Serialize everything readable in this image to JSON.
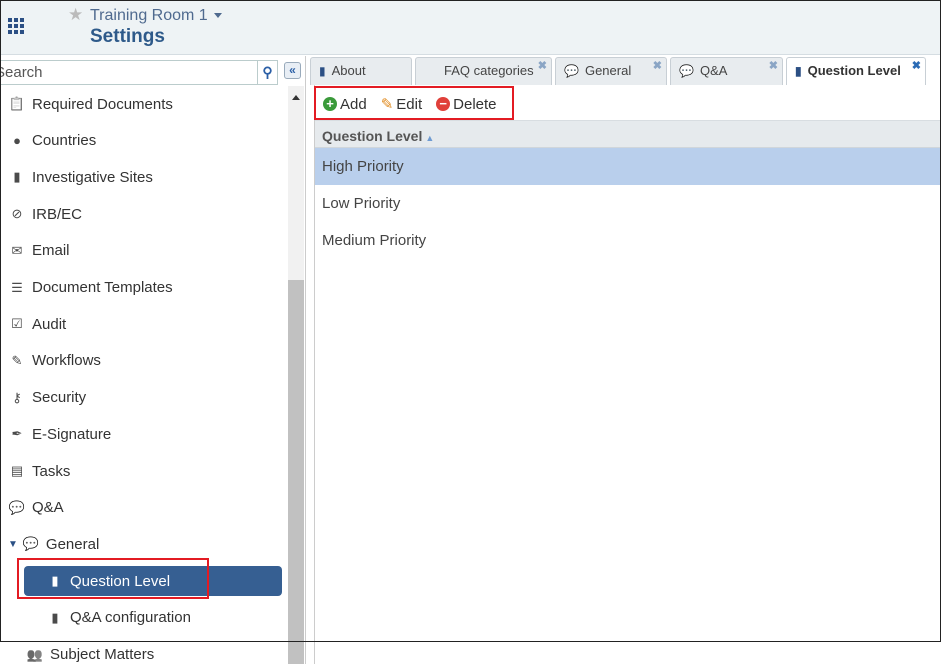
{
  "header": {
    "room": "Training Room 1",
    "title": "Settings",
    "apps_icon": "grid-icon",
    "star_icon": "star-icon"
  },
  "sidebar": {
    "search_placeholder": "Search",
    "items": [
      {
        "label": "Required Documents",
        "icon": "clipboard-icon"
      },
      {
        "label": "Countries",
        "icon": "globe-icon"
      },
      {
        "label": "Investigative Sites",
        "icon": "building-icon"
      },
      {
        "label": "IRB/EC",
        "icon": "check-circle-icon"
      },
      {
        "label": "Email",
        "icon": "envelope-icon"
      },
      {
        "label": "Document Templates",
        "icon": "list-icon"
      },
      {
        "label": "Audit",
        "icon": "checkbox-icon"
      },
      {
        "label": "Workflows",
        "icon": "pencil-icon"
      },
      {
        "label": "Security",
        "icon": "keys-icon"
      },
      {
        "label": "E-Signature",
        "icon": "pen-icon"
      },
      {
        "label": "Tasks",
        "icon": "table-icon"
      },
      {
        "label": "Q&A",
        "icon": "comments-icon"
      },
      {
        "label": "General",
        "icon": "comments-icon"
      },
      {
        "label": "Question Level",
        "icon": "file-icon",
        "selected": true
      },
      {
        "label": "Q&A configuration",
        "icon": "file-icon"
      },
      {
        "label": "Subject Matters",
        "icon": "users-icon"
      }
    ]
  },
  "tabs": [
    {
      "label": "About"
    },
    {
      "label": "FAQ categories"
    },
    {
      "label": "General"
    },
    {
      "label": "Q&A"
    },
    {
      "label": "Question Level",
      "active": true
    }
  ],
  "toolbar": {
    "add": "Add",
    "edit": "Edit",
    "delete": "Delete"
  },
  "grid": {
    "header": "Question Level",
    "rows": [
      "High Priority",
      "Low Priority",
      "Medium Priority"
    ]
  },
  "colors": {
    "accent": "#365f92",
    "highlight": "#e31b23",
    "selected_row": "#b9cfec"
  }
}
